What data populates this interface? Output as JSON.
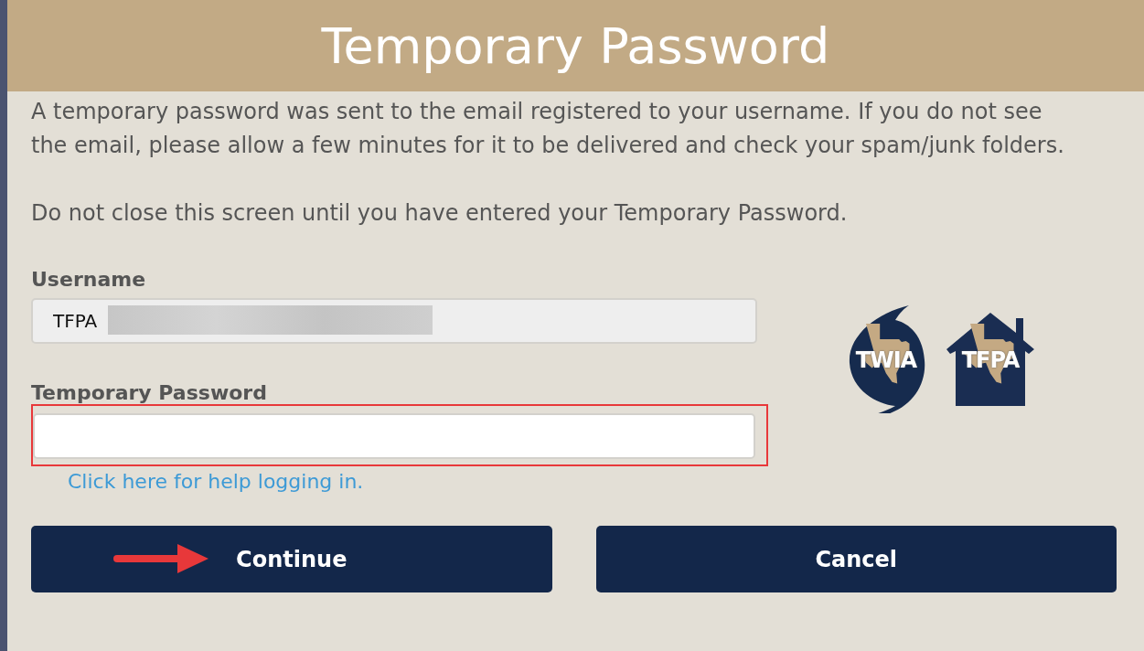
{
  "header": {
    "title": "Temporary Password"
  },
  "message": "A temporary password was sent to the email registered to your username. If you do not see the email, please allow a few minutes for it to be delivered and check your spam/junk folders.",
  "warning": "Do not close this screen until you have entered your Temporary Password.",
  "fields": [
    {
      "label": "Username",
      "value": "TFPA",
      "redacted": true,
      "highlighted": false,
      "disabled": true
    },
    {
      "label": "Temporary Password",
      "redacted": false,
      "highlighted": true,
      "disabled": false
    }
  ],
  "help_link": "Click here for help logging in.",
  "logos": [
    {
      "kind": "storm",
      "text": "TWIA"
    },
    {
      "kind": "house",
      "text": "TFPA"
    }
  ],
  "buttons": [
    {
      "label": "Continue",
      "pointed": true
    },
    {
      "label": "Cancel",
      "pointed": false
    }
  ]
}
